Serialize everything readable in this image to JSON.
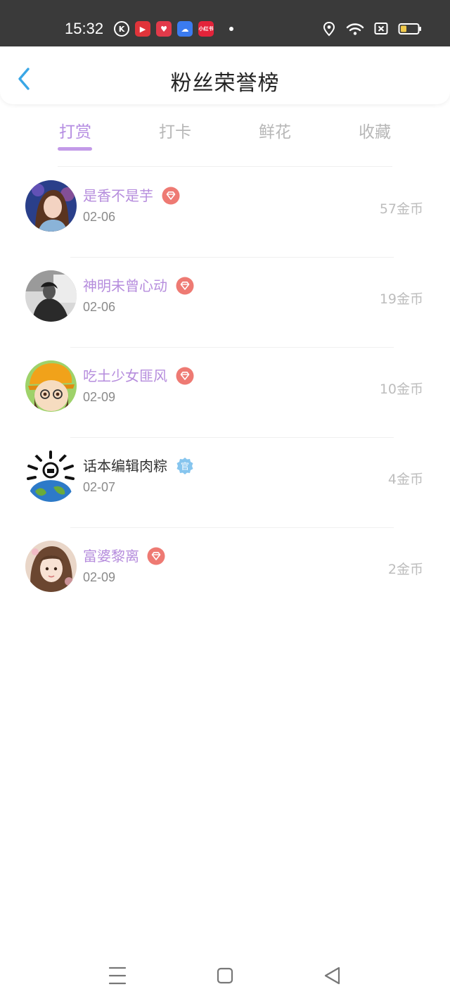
{
  "status_bar": {
    "time": "15:32",
    "apps": [
      "K",
      "▶",
      "♥",
      "☁",
      "小红书"
    ],
    "icons": [
      "location-icon",
      "wifi-icon",
      "sim-off-icon",
      "battery-icon"
    ]
  },
  "header": {
    "title": "粉丝荣誉榜",
    "back_icon": "chevron-left-icon"
  },
  "tabs": [
    {
      "label": "打赏",
      "active": true
    },
    {
      "label": "打卡",
      "active": false
    },
    {
      "label": "鲜花",
      "active": false
    },
    {
      "label": "收藏",
      "active": false
    }
  ],
  "fans": [
    {
      "name": "是香不是芋",
      "date": "02-06",
      "coins": "57金币",
      "badge": "diamond-badge-icon"
    },
    {
      "name": "神明未曾心动",
      "date": "02-06",
      "coins": "19金币",
      "badge": "diamond-badge-icon"
    },
    {
      "name": "吃土少女匪风",
      "date": "02-09",
      "coins": "10金币",
      "badge": "diamond-badge-icon"
    },
    {
      "name": "话本编辑肉粽",
      "date": "02-07",
      "coins": "4金币",
      "badge": "official-badge-icon",
      "badge_text": "官"
    },
    {
      "name": "富婆黎离",
      "date": "02-09",
      "coins": "2金币",
      "badge": "diamond-badge-icon"
    }
  ],
  "colors": {
    "accent": "#b58de2",
    "badge_red": "#ee7a73",
    "badge_blue": "#86c5ee",
    "status_bar": "#3a3a3a"
  }
}
